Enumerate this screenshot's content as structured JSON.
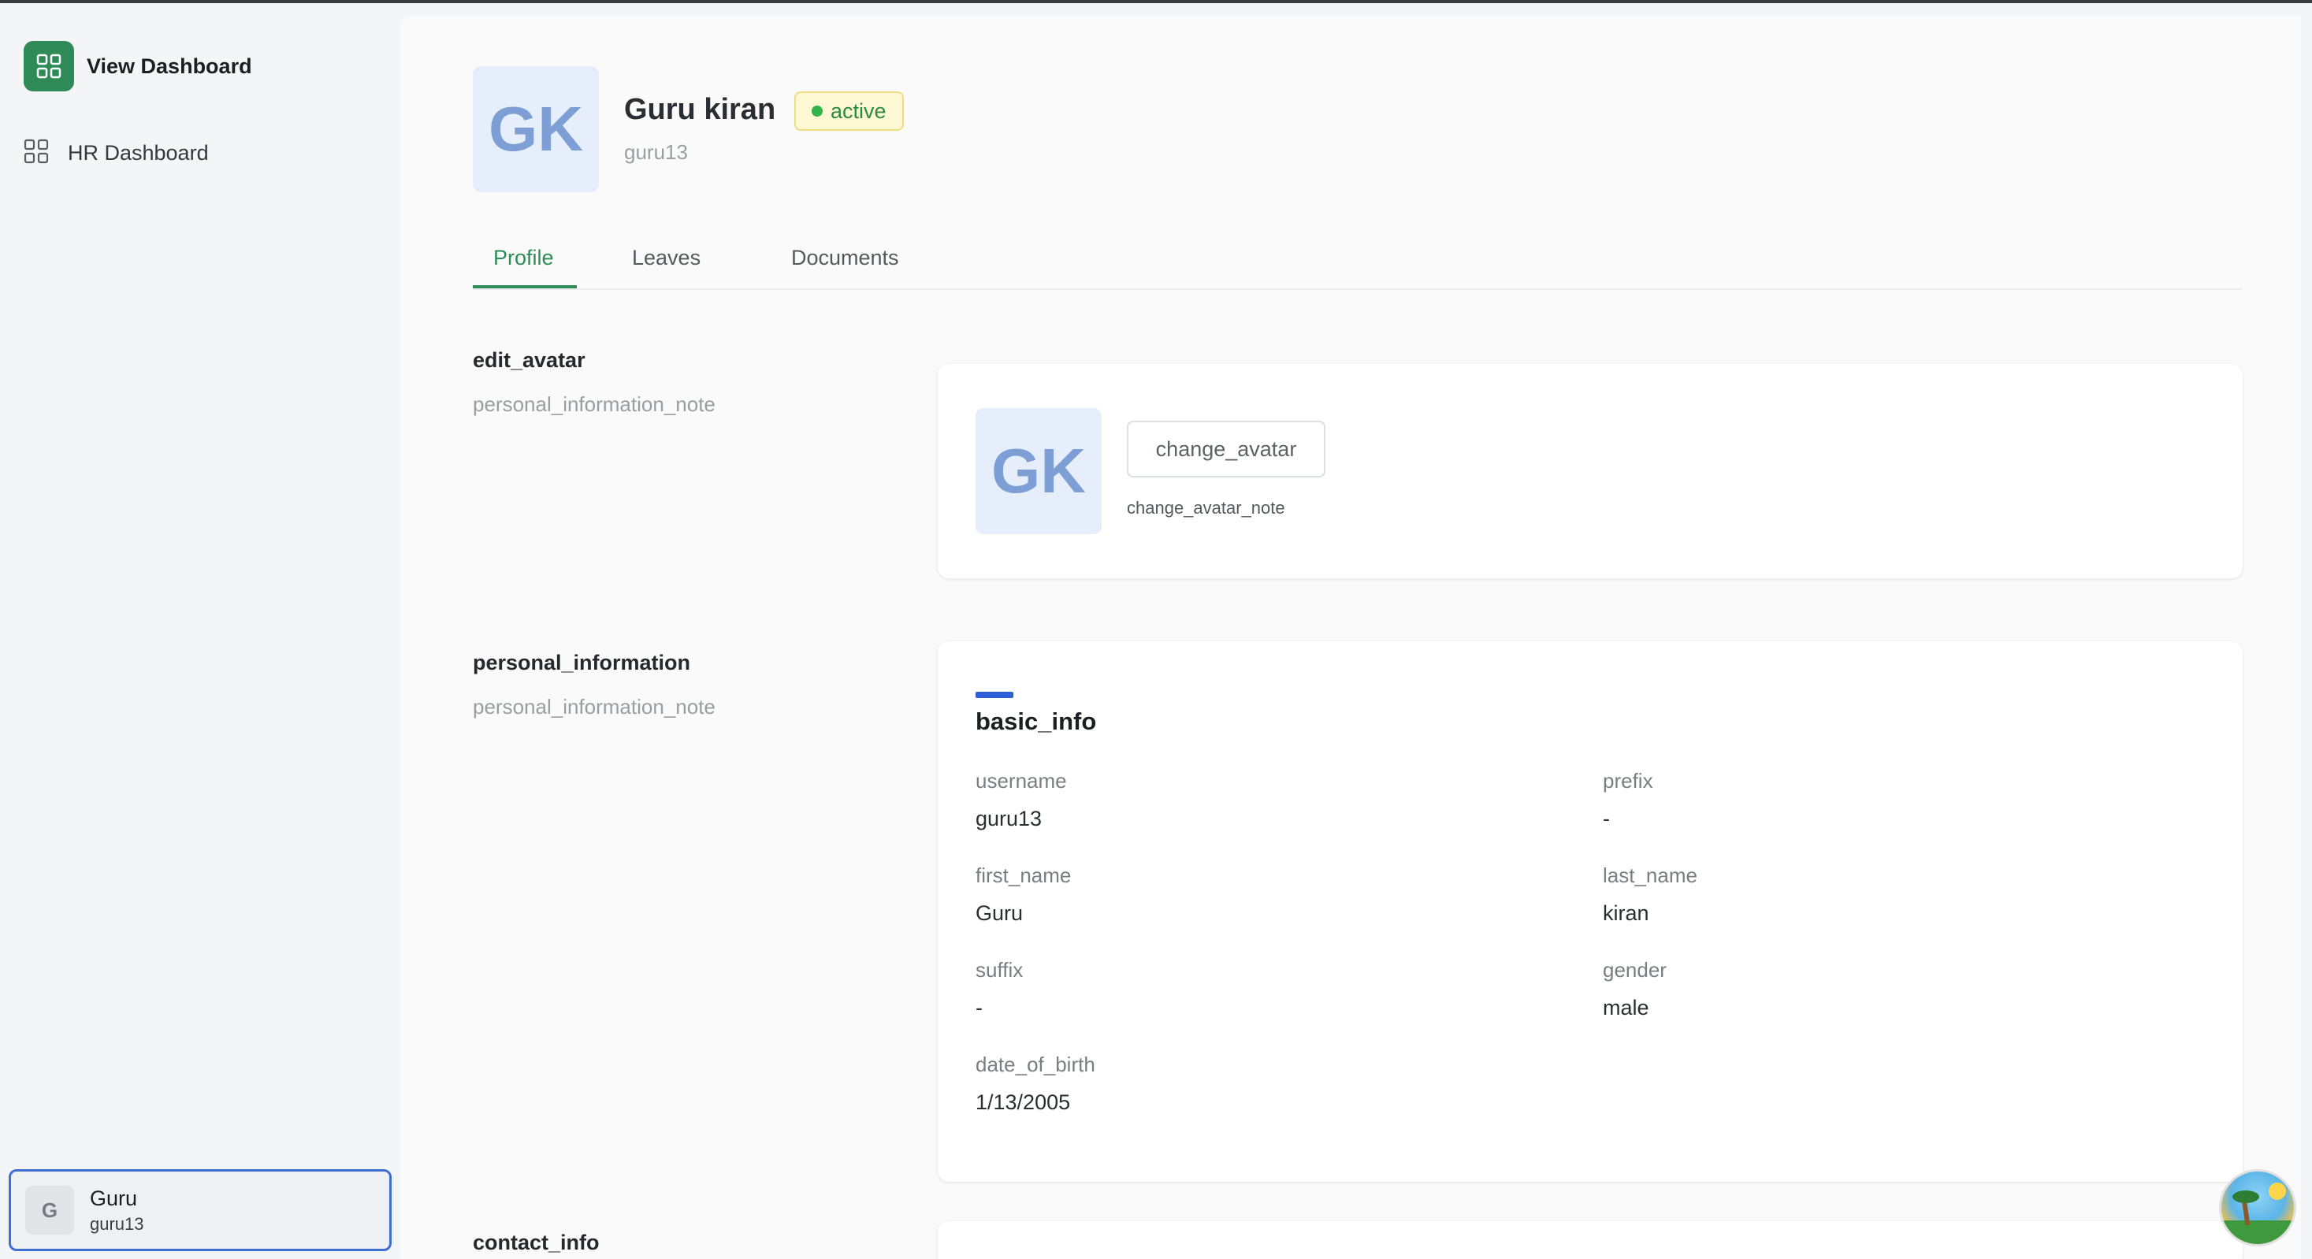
{
  "sidebar": {
    "brand_title": "View Dashboard",
    "items": [
      {
        "label": "HR Dashboard"
      }
    ],
    "user": {
      "initial": "G",
      "name": "Guru",
      "handle": "guru13"
    }
  },
  "header": {
    "initials": "GK",
    "name": "Guru kiran",
    "status": "active",
    "handle": "guru13"
  },
  "tabs": [
    {
      "label": "Profile",
      "active": true
    },
    {
      "label": "Leaves",
      "active": false
    },
    {
      "label": "Documents",
      "active": false
    }
  ],
  "avatar_section": {
    "title": "edit_avatar",
    "note": "personal_information_note",
    "initials": "GK",
    "button_label": "change_avatar",
    "button_note": "change_avatar_note"
  },
  "personal_section": {
    "title": "personal_information",
    "note": "personal_information_note",
    "card_title": "basic_info",
    "fields": {
      "username": {
        "label": "username",
        "value": "guru13"
      },
      "prefix": {
        "label": "prefix",
        "value": "-"
      },
      "first_name": {
        "label": "first_name",
        "value": "Guru"
      },
      "last_name": {
        "label": "last_name",
        "value": "kiran"
      },
      "suffix": {
        "label": "suffix",
        "value": "-"
      },
      "gender": {
        "label": "gender",
        "value": "male"
      },
      "date_of_birth": {
        "label": "date_of_birth",
        "value": "1/13/2005"
      }
    }
  },
  "contact_section": {
    "title": "contact_info"
  },
  "colors": {
    "brand": "#2e8b57",
    "accent_blue": "#2f5fd8",
    "status_green": "#33b249",
    "status_bg": "#fff8d4",
    "avatar_bg": "#e6eefb"
  },
  "icons": [
    "dashboard-grid-icon",
    "hr-dashboard-grid-icon"
  ]
}
